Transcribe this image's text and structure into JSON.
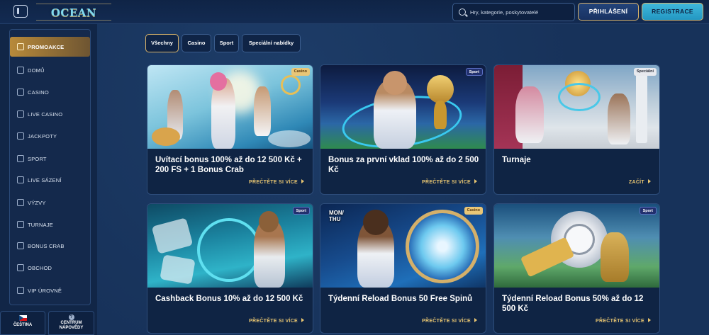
{
  "header": {
    "logo_text": "OCEAN SPIN",
    "search_placeholder": "Hry, kategorie, poskytovatelé",
    "login_label": "PŘIHLÁŠENÍ",
    "register_label": "REGISTRACE"
  },
  "sidebar": {
    "items": [
      {
        "label": "PROMOAKCE",
        "icon": "gift-icon",
        "active": true
      },
      {
        "label": "DOMŮ",
        "icon": "home-icon"
      },
      {
        "label": "CASINO",
        "icon": "slot-icon"
      },
      {
        "label": "LIVE CASINO",
        "icon": "tv-icon"
      },
      {
        "label": "JACKPOTY",
        "icon": "jackpot-icon"
      },
      {
        "label": "SPORT",
        "icon": "ball-icon"
      },
      {
        "label": "LIVE SÁZENÍ",
        "icon": "live-bet-icon"
      },
      {
        "label": "VÝZVY",
        "icon": "challenge-icon"
      },
      {
        "label": "TURNAJE",
        "icon": "trophy-icon"
      },
      {
        "label": "BONUS CRAB",
        "icon": "crab-icon"
      },
      {
        "label": "OBCHOD",
        "icon": "shop-icon"
      },
      {
        "label": "VIP ÚROVNĚ",
        "icon": "vip-icon"
      }
    ],
    "language_label": "ČEŠTINA",
    "help_label_line1": "CENTRUM",
    "help_label_line2": "NÁPOVĚDY",
    "help_icon_glyph": "?"
  },
  "filters": [
    "Všechny",
    "Casino",
    "Sport",
    "Speciální nabídky"
  ],
  "cards": [
    {
      "title": "Uvítací bonus 100% až do 12 500 Kč + 200 FS + 1 Bonus Crab",
      "badge": "Casino",
      "link": "PŘEČTĚTE SI VÍCE"
    },
    {
      "title": "Bonus za první vklad 100% až do 2 500 Kč",
      "badge": "Sport",
      "link": "PŘEČTĚTE SI VÍCE"
    },
    {
      "title": "Turnaje",
      "badge": "Speciální",
      "link": "ZAČÍT"
    },
    {
      "title": "Cashback Bonus 10% až do 12 500 Kč",
      "badge": "Sport",
      "link": "PŘEČTĚTE SI VÍCE"
    },
    {
      "title": "Týdenní Reload Bonus 50 Free Spinů",
      "badge": "Casino",
      "link": "PŘEČTĚTE SI VÍCE",
      "img_text": "MON/ THU"
    },
    {
      "title": "Týdenní Reload Bonus 50% až do 12 500 Kč",
      "badge": "Sport",
      "link": "PŘEČTĚTE SI VÍCE"
    }
  ],
  "colors": {
    "accent_gold": "#d8b36a",
    "register_cyan": "#2fa9d2",
    "background": "#17325a"
  }
}
